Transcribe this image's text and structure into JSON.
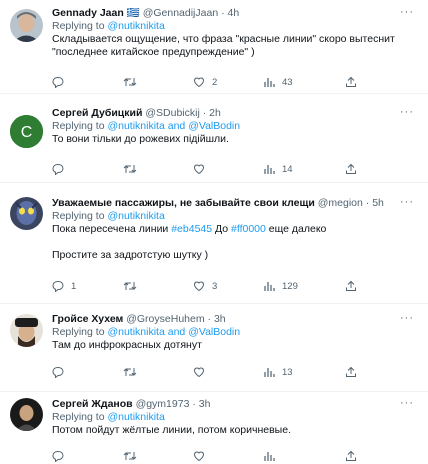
{
  "tweets": [
    {
      "name": "Gennady Jaan",
      "flag": "🇬🇷",
      "handle": "@GennadijJaan",
      "sep": "·",
      "time": "4h",
      "replying_prefix": "Replying to",
      "replying_to": "@nutiknikita",
      "replying_and": "",
      "replying_to2": "",
      "text": "Складывается ощущение, что фраза \"красные линии\" скоро вытеснит\n\"последнее китайское предупреждение\" )",
      "replies": "",
      "retweets": "",
      "likes": "2",
      "views": "43"
    },
    {
      "name": "Сергей Дубицкий",
      "handle": "@SDubickij",
      "sep": "·",
      "time": "2h",
      "avatar_letter": "C",
      "avatar_color": "#2e7d32",
      "replying_prefix": "Replying to",
      "replying_to": "@nutiknikita",
      "replying_and": "and",
      "replying_to2": "@ValBodin",
      "text": "То вони тільки до рожевих підійшли.",
      "replies": "",
      "retweets": "",
      "likes": "",
      "views": "14"
    },
    {
      "name": "Уважаемые пассажиры, не забывайте свои клещи",
      "handle": "@megion",
      "sep": "·",
      "time": "5h",
      "replying_prefix": "Replying to",
      "replying_to": "@nutiknikita",
      "replying_and": "",
      "replying_to2": "",
      "text_pre": "Пока пересечена линии ",
      "hashtag1": "#eb4545",
      "text_mid": " До ",
      "hashtag2": "#ff0000",
      "text_post": " еще далеко",
      "text2": "Простите за задротстую шутку )",
      "replies": "1",
      "retweets": "",
      "likes": "3",
      "views": "129"
    },
    {
      "name": "Гройсе Хухем",
      "handle": "@GroyseHuhem",
      "sep": "·",
      "time": "3h",
      "replying_prefix": "Replying to",
      "replying_to": "@nutiknikita",
      "replying_and": "and",
      "replying_to2": "@ValBodin",
      "text": "Там до инфрокрасных дотянут",
      "replies": "",
      "retweets": "",
      "likes": "",
      "views": "13"
    },
    {
      "name": "Сергей Жданов",
      "handle": "@gym1973",
      "sep": "·",
      "time": "3h",
      "replying_prefix": "Replying to",
      "replying_to": "@nutiknikita",
      "replying_and": "",
      "replying_to2": "",
      "text": "Потом пойдут жёлтые линии, потом коричневые.",
      "replies": "",
      "retweets": "",
      "likes": "",
      "views": ""
    }
  ],
  "ui": {
    "more": "···"
  },
  "icons": [
    "reply-icon",
    "retweet-icon",
    "like-icon",
    "views-icon",
    "share-icon",
    "more-icon"
  ],
  "colors": {
    "link": "#1d9bf0",
    "muted": "#536471",
    "text": "#0f1419",
    "divider": "#eff3f4"
  }
}
